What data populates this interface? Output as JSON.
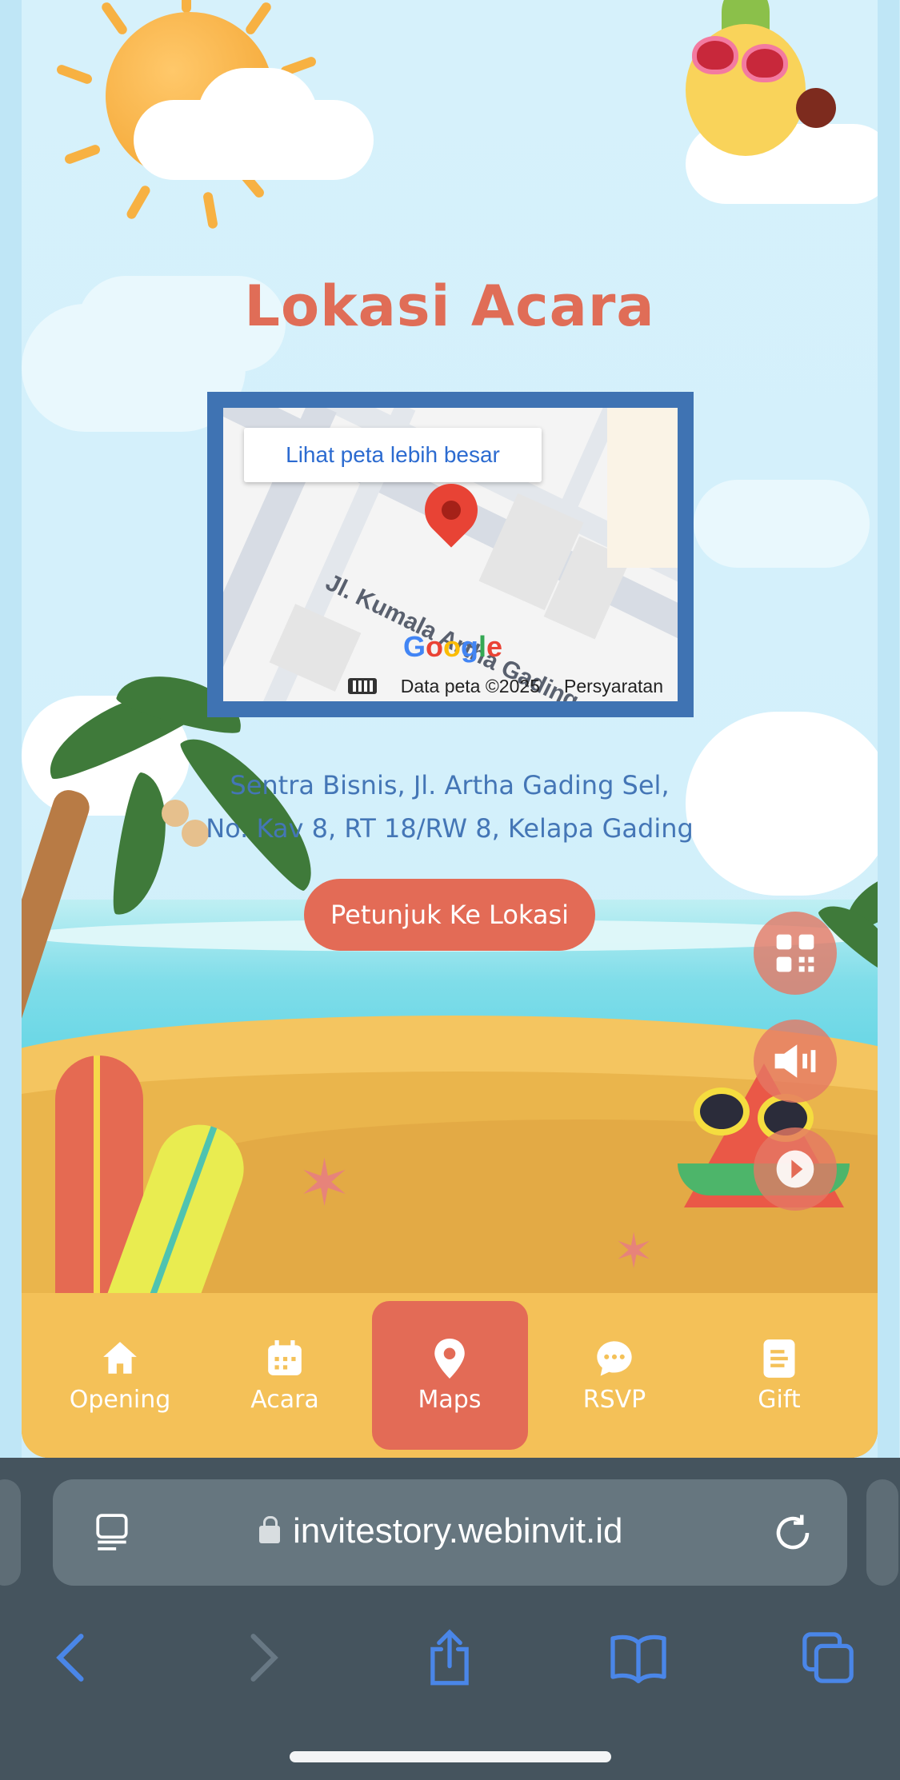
{
  "section": {
    "title": "Lokasi Acara",
    "address_line1": "Sentra Bisnis, Jl. Artha Gading Sel,",
    "address_line2": "No. Kav 8, RT 18/RW 8, Kelapa Gading",
    "directions_button": "Petunjuk Ke Lokasi"
  },
  "map": {
    "view_larger_button": "Lihat peta lebih besar",
    "street_label": "Jl. Kumala Artha Gading",
    "google_logo": "Google",
    "data_credit": "Data peta ©2025",
    "terms_link": "Persyaratan"
  },
  "floating_buttons": [
    {
      "icon": "qr-code-icon"
    },
    {
      "icon": "speaker-icon"
    },
    {
      "icon": "play-icon"
    }
  ],
  "bottom_nav": {
    "items": [
      {
        "label": "Opening",
        "icon": "home-icon",
        "active": false
      },
      {
        "label": "Acara",
        "icon": "calendar-icon",
        "active": false
      },
      {
        "label": "Maps",
        "icon": "map-pin-icon",
        "active": true
      },
      {
        "label": "RSVP",
        "icon": "chat-bubble-icon",
        "active": false
      },
      {
        "label": "Gift",
        "icon": "gift-list-icon",
        "active": false
      }
    ]
  },
  "browser": {
    "url": "invitestory.webinvit.id"
  },
  "colors": {
    "accent": "#e36b56",
    "nav_background": "#f4c158",
    "map_border": "#3f73b3",
    "address_text": "#4476b6",
    "browser_chrome": "#45545e",
    "browser_icons": "#4a86e8"
  }
}
